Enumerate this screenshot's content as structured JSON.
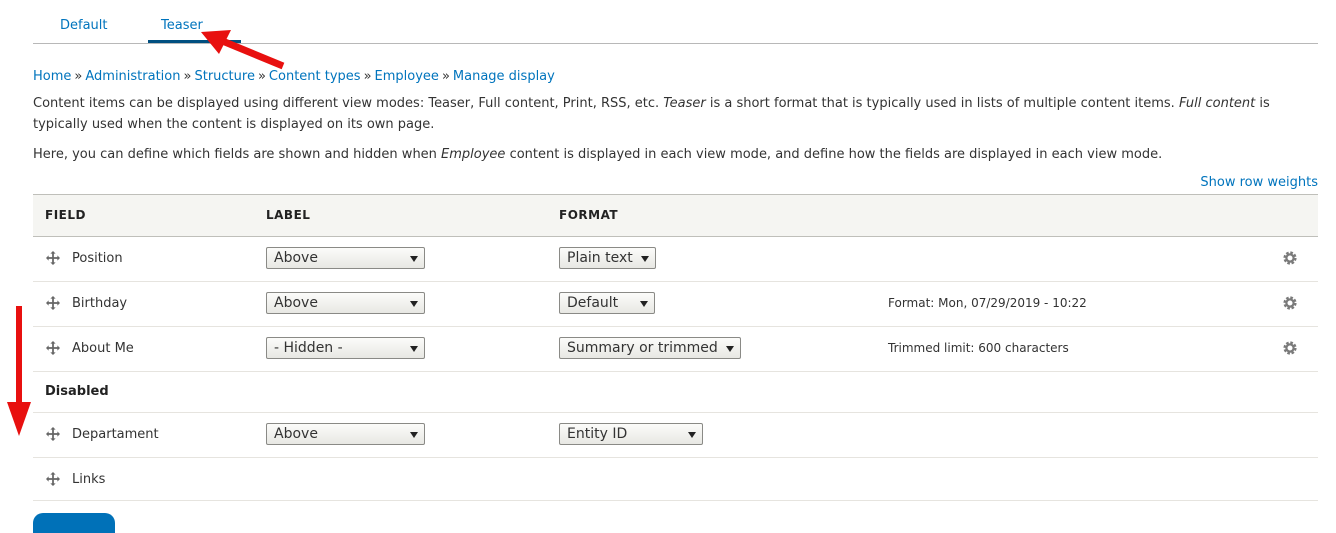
{
  "tabs": [
    {
      "label": "Default",
      "active": false
    },
    {
      "label": "Teaser",
      "active": true
    }
  ],
  "breadcrumb": [
    "Home",
    "Administration",
    "Structure",
    "Content types",
    "Employee",
    "Manage display"
  ],
  "breadcrumb_sep": "»",
  "description": {
    "p1_a": "Content items can be displayed using different view modes: Teaser, Full content, Print, RSS, etc. ",
    "p1_em1": "Teaser",
    "p1_b": " is a short format that is typically used in lists of multiple content items. ",
    "p1_em2": "Full content",
    "p1_c": " is typically used when the content is displayed on its own page.",
    "p2_a": "Here, you can define which fields are shown and hidden when ",
    "p2_em": "Employee",
    "p2_b": " content is displayed in each view mode, and define how the fields are displayed in each view mode."
  },
  "show_row_weights": "Show row weights",
  "table": {
    "headers": {
      "field": "FIELD",
      "label": "LABEL",
      "format": "FORMAT"
    },
    "rows": [
      {
        "field": "Position",
        "label": "Above",
        "format": "Plain text",
        "summary": ""
      },
      {
        "field": "Birthday",
        "label": "Above",
        "format": "Default",
        "summary": "Format: Mon, 07/29/2019 - 10:22"
      },
      {
        "field": "About Me",
        "label": "- Hidden -",
        "format": "Summary or trimmed",
        "summary": "Trimmed limit: 600 characters"
      }
    ],
    "disabled_title": "Disabled",
    "disabled_rows": [
      {
        "field": "Departament",
        "label": "Above",
        "format": "Entity ID"
      },
      {
        "field": "Links"
      }
    ]
  },
  "colors": {
    "link": "#0074bd",
    "annotation_arrow": "#e8100f",
    "primary_button": "#0071b8"
  },
  "icons": [
    "drag-handle-icon",
    "gear-icon",
    "dropdown-arrow-icon"
  ]
}
